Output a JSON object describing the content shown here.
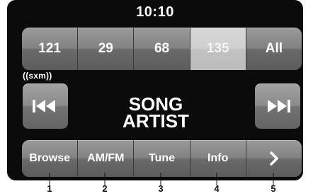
{
  "clock": "10:10",
  "presets": [
    "121",
    "29",
    "68",
    "135",
    "All"
  ],
  "active_preset": "135",
  "brand": "((sxm))",
  "transport": {
    "prev_icon": "skip-previous-icon",
    "next_icon": "skip-next-icon"
  },
  "now_playing": {
    "song": "SONG",
    "artist": "ARTIST"
  },
  "function_bar": {
    "browse": "Browse",
    "amfm": "AM/FM",
    "tune": "Tune",
    "info": "Info",
    "more_icon": "chevron-right-icon"
  },
  "callouts": [
    "1",
    "2",
    "3",
    "4",
    "5"
  ],
  "colors": {
    "screen_bg": "#0b0b0b",
    "button": "#828282",
    "active_preset": "#cfcfcf",
    "text": "#ffffff"
  }
}
